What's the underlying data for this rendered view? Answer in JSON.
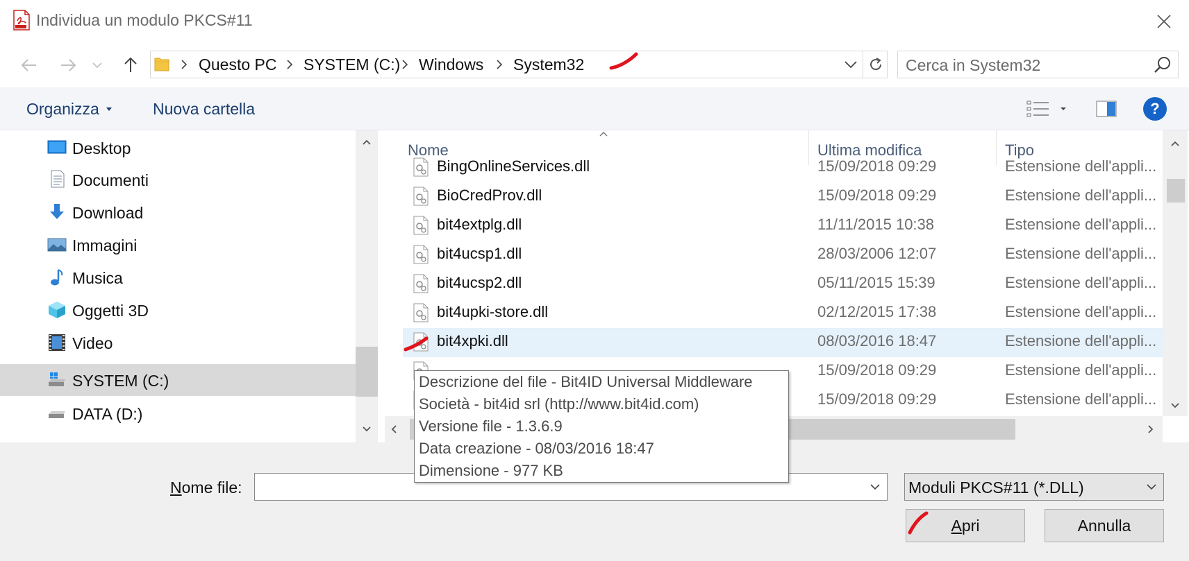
{
  "window": {
    "title": "Individua un modulo PKCS#11"
  },
  "nav": {
    "breadcrumbs": [
      "Questo PC",
      "SYSTEM (C:)",
      "Windows",
      "System32"
    ],
    "search_placeholder": "Cerca in System32"
  },
  "toolbar": {
    "organize_label": "Organizza",
    "new_folder_label": "Nuova cartella",
    "help_label": "?"
  },
  "tree": {
    "items": [
      {
        "label": "Desktop",
        "icon": "desktop-icon"
      },
      {
        "label": "Documenti",
        "icon": "documents-icon"
      },
      {
        "label": "Download",
        "icon": "download-icon"
      },
      {
        "label": "Immagini",
        "icon": "pictures-icon"
      },
      {
        "label": "Musica",
        "icon": "music-icon"
      },
      {
        "label": "Oggetti 3D",
        "icon": "objects3d-icon"
      },
      {
        "label": "Video",
        "icon": "video-icon"
      },
      {
        "label": "SYSTEM (C:)",
        "icon": "system-drive-icon",
        "selected": true
      },
      {
        "label": "DATA (D:)",
        "icon": "data-drive-icon"
      }
    ]
  },
  "filelist": {
    "columns": {
      "name": "Nome",
      "modified": "Ultima modifica",
      "type": "Tipo"
    },
    "rows": [
      {
        "name": "BingOnlineServices.dll",
        "modified": "15/09/2018 09:29",
        "type": "Estensione dell'appli..."
      },
      {
        "name": "BioCredProv.dll",
        "modified": "15/09/2018 09:29",
        "type": "Estensione dell'appli..."
      },
      {
        "name": "bit4extplg.dll",
        "modified": "11/11/2015 10:38",
        "type": "Estensione dell'appli..."
      },
      {
        "name": "bit4ucsp1.dll",
        "modified": "28/03/2006 12:07",
        "type": "Estensione dell'appli..."
      },
      {
        "name": "bit4ucsp2.dll",
        "modified": "05/11/2015 15:39",
        "type": "Estensione dell'appli..."
      },
      {
        "name": "bit4upki-store.dll",
        "modified": "02/12/2015 17:38",
        "type": "Estensione dell'appli..."
      },
      {
        "name": "bit4xpki.dll",
        "modified": "08/03/2016 18:47",
        "type": "Estensione dell'appli...",
        "selected": true
      },
      {
        "name": "",
        "modified": "15/09/2018 09:29",
        "type": "Estensione dell'appli..."
      },
      {
        "name": "",
        "modified": "15/09/2018 09:29",
        "type": "Estensione dell'appli..."
      }
    ]
  },
  "tooltip": {
    "lines": [
      "Descrizione del file - Bit4ID Universal Middleware",
      "Società - bit4id srl (http://www.bit4id.com)",
      "Versione file - 1.3.6.9",
      "Data creazione - 08/03/2016 18:47",
      "Dimensione - 977 KB"
    ]
  },
  "footer": {
    "filename_label_accel": "N",
    "filename_label_rest": "ome file:",
    "filename_value": "",
    "filter_value": "Moduli PKCS#11 (*.DLL)",
    "open_accel": "A",
    "open_rest": "pri",
    "cancel_label": "Annulla"
  },
  "colors": {
    "accent": "#1663c7",
    "selection": "#e5f1fb",
    "tree_selected": "#d9d9d9",
    "annotation_red": "#e0141e"
  }
}
